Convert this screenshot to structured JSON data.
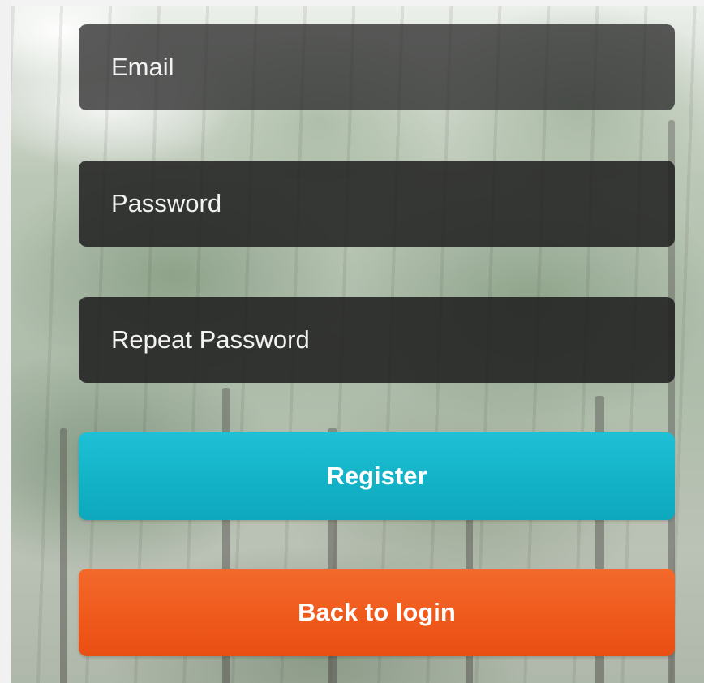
{
  "form": {
    "email": {
      "placeholder": "Email",
      "value": ""
    },
    "password": {
      "placeholder": "Password",
      "value": ""
    },
    "repeat_password": {
      "placeholder": "Repeat Password",
      "value": ""
    },
    "register_label": "Register",
    "back_label": "Back to login"
  },
  "colors": {
    "register_button": "#13b2c7",
    "back_button": "#ef5a1c",
    "field_background": "#262626",
    "field_text": "#ffffff"
  }
}
